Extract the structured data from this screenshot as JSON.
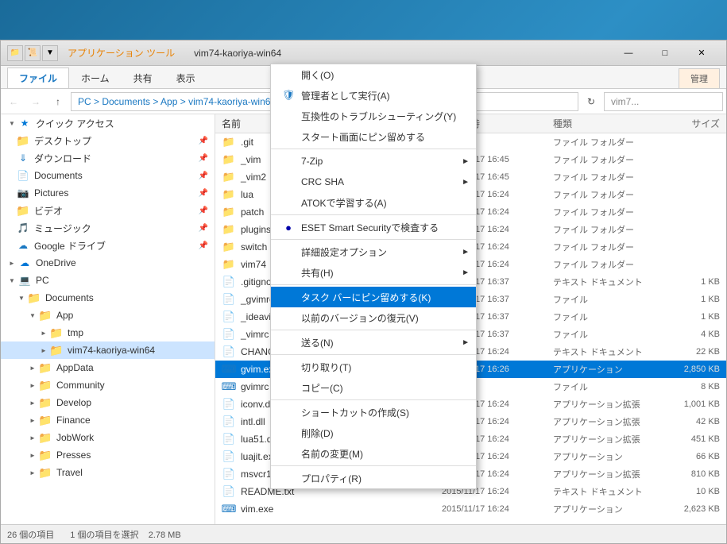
{
  "window": {
    "title": "vim74-kaoriya-win64",
    "title_bar_extra": "アプリケーション ツール"
  },
  "ribbon": {
    "tabs": [
      "ファイル",
      "ホーム",
      "共有",
      "表示",
      "管理"
    ]
  },
  "address": {
    "path": "PC > Documents > App > vim74-kaoriya-win64",
    "search_placeholder": "vim7...",
    "search_label": "vim7..."
  },
  "sidebar": {
    "quick_access_label": "クイック アクセス",
    "items": [
      {
        "label": "デスクトップ",
        "indent": 1,
        "pin": true
      },
      {
        "label": "ダウンロード",
        "indent": 1,
        "pin": true
      },
      {
        "label": "Documents",
        "indent": 1,
        "pin": true
      },
      {
        "label": "Pictures",
        "indent": 1,
        "pin": true
      },
      {
        "label": "ビデオ",
        "indent": 1,
        "pin": true
      },
      {
        "label": "ミュージック",
        "indent": 1,
        "pin": true
      },
      {
        "label": "Google ドライブ",
        "indent": 1,
        "pin": true
      },
      {
        "label": "OneDrive",
        "indent": 0
      },
      {
        "label": "PC",
        "indent": 0,
        "expanded": true
      },
      {
        "label": "Documents",
        "indent": 1,
        "expanded": true
      },
      {
        "label": "App",
        "indent": 2,
        "expanded": true
      },
      {
        "label": "tmp",
        "indent": 3
      },
      {
        "label": "vim74-kaoriya-win64",
        "indent": 3,
        "selected": true
      },
      {
        "label": "AppData",
        "indent": 2
      },
      {
        "label": "Community",
        "indent": 2
      },
      {
        "label": "Develop",
        "indent": 2
      },
      {
        "label": "Finance",
        "indent": 2
      },
      {
        "label": "JobWork",
        "indent": 2
      },
      {
        "label": "Presses",
        "indent": 2
      },
      {
        "label": "Travel",
        "indent": 2
      }
    ]
  },
  "file_list": {
    "columns": [
      "名前",
      "更新日時",
      "種類",
      "サイズ"
    ],
    "items": [
      {
        "name": ".git",
        "date": "",
        "type": "ファイル フォルダー",
        "size": "",
        "is_folder": true
      },
      {
        "name": "_vim",
        "date": "2015/11/17 16:45",
        "type": "ファイル フォルダー",
        "size": "",
        "is_folder": true
      },
      {
        "name": "_vim2",
        "date": "2015/11/17 16:45",
        "type": "ファイル フォルダー",
        "size": "",
        "is_folder": true
      },
      {
        "name": "lua",
        "date": "2015/11/17 16:24",
        "type": "ファイル フォルダー",
        "size": "",
        "is_folder": true
      },
      {
        "name": "patch",
        "date": "2015/11/17 16:24",
        "type": "ファイル フォルダー",
        "size": "",
        "is_folder": true
      },
      {
        "name": "plugins",
        "date": "2015/11/17 16:24",
        "type": "ファイル フォルダー",
        "size": "",
        "is_folder": true
      },
      {
        "name": "switch",
        "date": "2015/11/17 16:24",
        "type": "ファイル フォルダー",
        "size": "",
        "is_folder": true
      },
      {
        "name": "vim74",
        "date": "2015/11/17 16:24",
        "type": "ファイル フォルダー",
        "size": "",
        "is_folder": true
      },
      {
        "name": ".gitignore",
        "date": "2015/11/17 16:37",
        "type": "テキスト ドキュメント",
        "size": "1 KB",
        "is_folder": false
      },
      {
        "name": "_gvimrc",
        "date": "2015/11/17 16:37",
        "type": "ファイル",
        "size": "1 KB",
        "is_folder": false
      },
      {
        "name": "_ideavimrc",
        "date": "2015/11/17 16:37",
        "type": "ファイル",
        "size": "1 KB",
        "is_folder": false
      },
      {
        "name": "_vimrc",
        "date": "2015/11/17 16:37",
        "type": "ファイル",
        "size": "4 KB",
        "is_folder": false
      },
      {
        "name": "CHANGELOG",
        "date": "2015/11/17 16:24",
        "type": "テキスト ドキュメント",
        "size": "22 KB",
        "is_folder": false
      },
      {
        "name": "gvim.exe",
        "date": "2015/11/17 16:26",
        "type": "アプリケーション",
        "size": "2,850 KB",
        "is_folder": false,
        "highlighted": true
      },
      {
        "name": "gvimrc",
        "date": "",
        "type": "ファイル",
        "size": "8 KB",
        "is_folder": false
      },
      {
        "name": "iconv.dll",
        "date": "2015/11/17 16:24",
        "type": "アプリケーション拡張",
        "size": "1,001 KB",
        "is_folder": false
      },
      {
        "name": "intl.dll",
        "date": "2015/11/17 16:24",
        "type": "アプリケーション拡張",
        "size": "42 KB",
        "is_folder": false
      },
      {
        "name": "lua51.dll",
        "date": "2015/11/17 16:24",
        "type": "アプリケーション拡張",
        "size": "451 KB",
        "is_folder": false
      },
      {
        "name": "luajit.exe",
        "date": "2015/11/17 16:24",
        "type": "アプリケーション",
        "size": "66 KB",
        "is_folder": false
      },
      {
        "name": "msvcr100.dll",
        "date": "2015/11/17 16:24",
        "type": "アプリケーション拡張",
        "size": "810 KB",
        "is_folder": false
      },
      {
        "name": "README.txt",
        "date": "2015/11/17 16:24",
        "type": "テキスト ドキュメント",
        "size": "10 KB",
        "is_folder": false
      },
      {
        "name": "vim.exe",
        "date": "2015/11/17 16:24",
        "type": "アプリケーション",
        "size": "2,623 KB",
        "is_folder": false
      }
    ]
  },
  "status_bar": {
    "count": "26 個の項目",
    "selected": "1 個の項目を選択",
    "size": "2.78 MB"
  },
  "context_menu": {
    "items": [
      {
        "label": "開く(O)",
        "icon": "",
        "has_arrow": false,
        "separator_after": false
      },
      {
        "label": "管理者として実行(A)",
        "icon": "shield",
        "has_arrow": false,
        "separator_after": false
      },
      {
        "label": "互換性のトラブルシューティング(Y)",
        "icon": "",
        "has_arrow": false,
        "separator_after": false
      },
      {
        "label": "スタート画面にピン留めする",
        "icon": "",
        "has_arrow": false,
        "separator_after": false
      },
      {
        "label": "7-Zip",
        "icon": "",
        "has_arrow": true,
        "separator_after": false
      },
      {
        "label": "CRC SHA",
        "icon": "",
        "has_arrow": true,
        "separator_after": false
      },
      {
        "label": "ATOKで学習する(A)",
        "icon": "",
        "has_arrow": false,
        "separator_after": false
      },
      {
        "label": "ESET Smart Securityで検査する",
        "icon": "eset",
        "has_arrow": false,
        "separator_after": false
      },
      {
        "label": "詳細設定オプション",
        "icon": "",
        "has_arrow": true,
        "separator_after": false
      },
      {
        "label": "共有(H)",
        "icon": "",
        "has_arrow": true,
        "separator_after": false
      },
      {
        "label": "タスク バーにピン留めする(K)",
        "icon": "",
        "has_arrow": false,
        "separator_after": false,
        "active": true
      },
      {
        "label": "以前のバージョンの復元(V)",
        "icon": "",
        "has_arrow": false,
        "separator_after": false
      },
      {
        "label": "送る(N)",
        "icon": "",
        "has_arrow": true,
        "separator_after": false
      },
      {
        "label": "切り取り(T)",
        "icon": "",
        "has_arrow": false,
        "separator_after": false
      },
      {
        "label": "コピー(C)",
        "icon": "",
        "has_arrow": false,
        "separator_after": false
      },
      {
        "label": "ショートカットの作成(S)",
        "icon": "",
        "has_arrow": false,
        "separator_after": false
      },
      {
        "label": "削除(D)",
        "icon": "",
        "has_arrow": false,
        "separator_after": false
      },
      {
        "label": "名前の変更(M)",
        "icon": "",
        "has_arrow": false,
        "separator_after": false
      },
      {
        "label": "プロパティ(R)",
        "icon": "",
        "has_arrow": false,
        "separator_after": false
      }
    ]
  }
}
